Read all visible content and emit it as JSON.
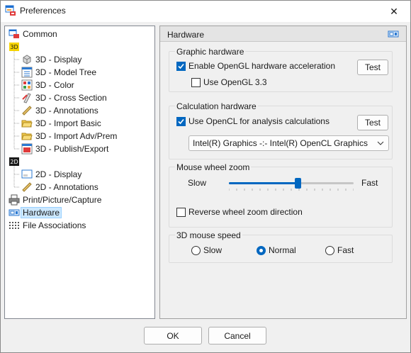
{
  "window": {
    "title": "Preferences",
    "close_glyph": "✕"
  },
  "tree": {
    "items": [
      {
        "label": "Common",
        "icon": "common-icon"
      },
      {
        "label": "3D",
        "icon": "3d-folder-icon"
      },
      {
        "label": "3D - Display",
        "icon": "cube-icon"
      },
      {
        "label": "3D - Model Tree",
        "icon": "model-tree-icon"
      },
      {
        "label": "3D - Color",
        "icon": "color-palette-icon"
      },
      {
        "label": "3D - Cross Section",
        "icon": "cross-section-icon"
      },
      {
        "label": "3D - Annotations",
        "icon": "ruler-icon"
      },
      {
        "label": "3D - Import Basic",
        "icon": "folder-open-icon"
      },
      {
        "label": "3D - Import Adv/Prem",
        "icon": "folder-open-icon"
      },
      {
        "label": "3D - Publish/Export",
        "icon": "publish-icon"
      },
      {
        "label": "2D",
        "icon": "2d-folder-icon"
      },
      {
        "label": "2D - Display",
        "icon": "display-2d-icon"
      },
      {
        "label": "2D - Annotations",
        "icon": "ruler-icon"
      },
      {
        "label": "Print/Picture/Capture",
        "icon": "printer-icon"
      },
      {
        "label": "Hardware",
        "icon": "hardware-icon"
      },
      {
        "label": "File Associations",
        "icon": "file-associations-icon"
      }
    ],
    "selected": "Hardware",
    "badge_3d": "3D",
    "badge_2d": "2D"
  },
  "panel": {
    "title": "Hardware",
    "graphic": {
      "label": "Graphic hardware",
      "enable_opengl": {
        "label": "Enable OpenGL hardware acceleration",
        "checked": true
      },
      "use_opengl33": {
        "label": "Use OpenGL 3.3",
        "checked": false
      },
      "test_label": "Test"
    },
    "calculation": {
      "label": "Calculation hardware",
      "use_opencl": {
        "label": "Use OpenCL for analysis calculations",
        "checked": true
      },
      "test_label": "Test",
      "device": "Intel(R) Graphics -:- Intel(R) OpenCL Graphics"
    },
    "wheel": {
      "label": "Mouse wheel zoom",
      "slow": "Slow",
      "fast": "Fast",
      "position": 0.55,
      "reverse": {
        "label": "Reverse wheel zoom direction",
        "checked": false
      }
    },
    "mouse3d": {
      "label": "3D mouse speed",
      "options": [
        "Slow",
        "Normal",
        "Fast"
      ],
      "selected": "Normal"
    }
  },
  "footer": {
    "ok": "OK",
    "cancel": "Cancel"
  },
  "colors": {
    "accent": "#0067c0",
    "selection": "#cce8ff"
  }
}
